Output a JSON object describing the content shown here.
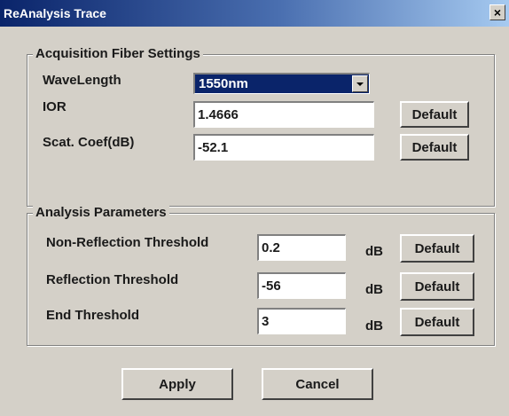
{
  "window": {
    "title": "ReAnalysis Trace",
    "close_label": "×"
  },
  "acquisition": {
    "legend": "Acquisition Fiber Settings",
    "wavelength_label": "WaveLength",
    "wavelength_value": "1550nm",
    "ior_label": "IOR",
    "ior_value": "1.4666",
    "scat_label": "Scat. Coef(dB)",
    "scat_value": "-52.1",
    "default_label": "Default"
  },
  "analysis": {
    "legend": "Analysis Parameters",
    "nonref_label": "Non-Reflection Threshold",
    "nonref_value": "0.2",
    "ref_label": "Reflection Threshold",
    "ref_value": "-56",
    "end_label": "End Threshold",
    "end_value": "3",
    "unit": "dB",
    "default_label": "Default"
  },
  "actions": {
    "apply_label": "Apply",
    "cancel_label": "Cancel"
  }
}
